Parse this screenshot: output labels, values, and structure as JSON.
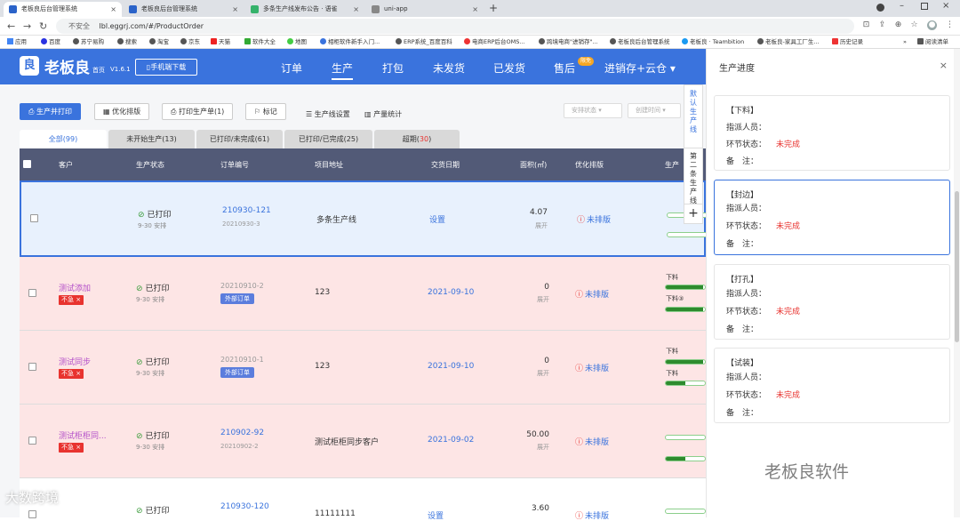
{
  "browser": {
    "tabs": [
      {
        "label": "老板良后台管理系统",
        "active": true
      },
      {
        "label": "老板良后台管理系统",
        "active": false
      },
      {
        "label": "多条生产线发布公告 · 语雀",
        "active": false
      },
      {
        "label": "uni-app",
        "active": false
      }
    ],
    "new_tab": "+",
    "url_security": "不安全",
    "url": "lbl.eggrj.com/#/ProductOrder",
    "bookmarks": [
      "应用",
      "百度",
      "苏宁易购",
      "搜索",
      "淘宝",
      "京东",
      "天猫",
      "软件大全",
      "地图",
      "相柜软件新手入门...",
      "ERP系统_百度百科",
      "电商ERP后台OMS...",
      "跨境电商\"进销存\"...",
      "老板良后台管理系统",
      "老板良 · Teambition",
      "老板良-家具工厂生...",
      "历史记录"
    ],
    "reading_list": "阅读清单"
  },
  "app": {
    "logo_char": "良",
    "name": "老板良",
    "home": "首页",
    "version": "V1.6.1",
    "mobile_download": "手机端下载",
    "nav": [
      "订单",
      "生产",
      "打包",
      "未发货",
      "已发货",
      "售后",
      "进销存+云仓 ▾"
    ],
    "active_nav": "生产",
    "nav_badge": "限免"
  },
  "toolbar": {
    "produce_print": "生产并打印",
    "optimize": "优化排版",
    "print_order": "打印生产单(1)",
    "mark": "标记",
    "line_settings": "生产线设置",
    "output_stats": "产量统计",
    "schedule_status": "安排状态",
    "create_time": "创建时间"
  },
  "filter_tabs": [
    {
      "label": "全部",
      "count": "99"
    },
    {
      "label": "未开始生产",
      "count": "13"
    },
    {
      "label": "已打印/未完成",
      "count": "61"
    },
    {
      "label": "已打印/已完成",
      "count": "25"
    },
    {
      "label": "超期",
      "count": "30"
    }
  ],
  "table": {
    "headers": [
      "客户",
      "生产状态",
      "订单编号",
      "项目地址",
      "交货日期",
      "面积(㎡)",
      "优化排版",
      "生产"
    ],
    "rows": [
      {
        "customer": "",
        "tag": "",
        "status": "已打印",
        "status_sub": "9-30 安排",
        "order": "210930-121",
        "order_sub": "20210930-3",
        "external": "",
        "address": "多条生产线",
        "delivery": "设置",
        "area": "4.07",
        "area_sub": "展开",
        "optimize": "未排版",
        "progress": [
          {
            "label": "",
            "value": 0
          },
          {
            "label": "",
            "value": 0
          }
        ]
      },
      {
        "customer": "测试添加",
        "tag": "不急 ×",
        "status": "已打印",
        "status_sub": "9-30 安排",
        "order": "20210910-2",
        "order_sub": "",
        "external": "外部订单",
        "address": "123",
        "delivery": "2021-09-10",
        "area": "0",
        "area_sub": "展开",
        "optimize": "未排版",
        "progress": [
          {
            "label": "下料",
            "value": 0.95
          },
          {
            "label": "下料③",
            "value": 0.95
          }
        ]
      },
      {
        "customer": "测试同步",
        "tag": "不急 ×",
        "status": "已打印",
        "status_sub": "9-30 安排",
        "order": "20210910-1",
        "order_sub": "",
        "external": "外部订单",
        "address": "123",
        "delivery": "2021-09-10",
        "area": "0",
        "area_sub": "展开",
        "optimize": "未排版",
        "progress": [
          {
            "label": "下料",
            "value": 0.95
          },
          {
            "label": "下料",
            "value": 0.5
          }
        ]
      },
      {
        "customer": "测试柜柜同...",
        "tag": "不急 ×",
        "status": "已打印",
        "status_sub": "9-30 安排",
        "order": "210902-92",
        "order_sub": "20210902-2",
        "external": "",
        "address": "测试柜柜同步客户",
        "delivery": "2021-09-02",
        "area": "50.00",
        "area_sub": "展开",
        "optimize": "未排版",
        "progress": [
          {
            "label": "",
            "value": 0
          },
          {
            "label": "",
            "value": 0.5
          }
        ]
      },
      {
        "customer": "",
        "tag": "",
        "status": "已打印",
        "status_sub": "",
        "order": "210930-120",
        "order_sub": "",
        "external": "",
        "address": "11111111",
        "delivery": "设置",
        "area": "3.60",
        "area_sub": "",
        "optimize": "未排版",
        "progress": [
          {
            "label": "",
            "value": 0
          }
        ]
      }
    ]
  },
  "side_strip": {
    "line1": "默认生产线",
    "line2": "第二条生产线",
    "add": "+"
  },
  "drawer": {
    "title": "生产进度",
    "close": "×",
    "cards": [
      {
        "title": "【下料】",
        "assignee_label": "指派人员：",
        "status_label": "环节状态：",
        "status": "未完成",
        "note_label": "备　注："
      },
      {
        "title": "【封边】",
        "assignee_label": "指派人员：",
        "status_label": "环节状态：",
        "status": "未完成",
        "note_label": "备　注："
      },
      {
        "title": "【打孔】",
        "assignee_label": "指派人员：",
        "status_label": "环节状态：",
        "status": "未完成",
        "note_label": "备　注："
      },
      {
        "title": "【试装】",
        "assignee_label": "指派人员：",
        "status_label": "环节状态：",
        "status": "未完成",
        "note_label": "备　注："
      }
    ]
  },
  "watermarks": {
    "left": "大数跨境",
    "right": "老板良软件"
  }
}
